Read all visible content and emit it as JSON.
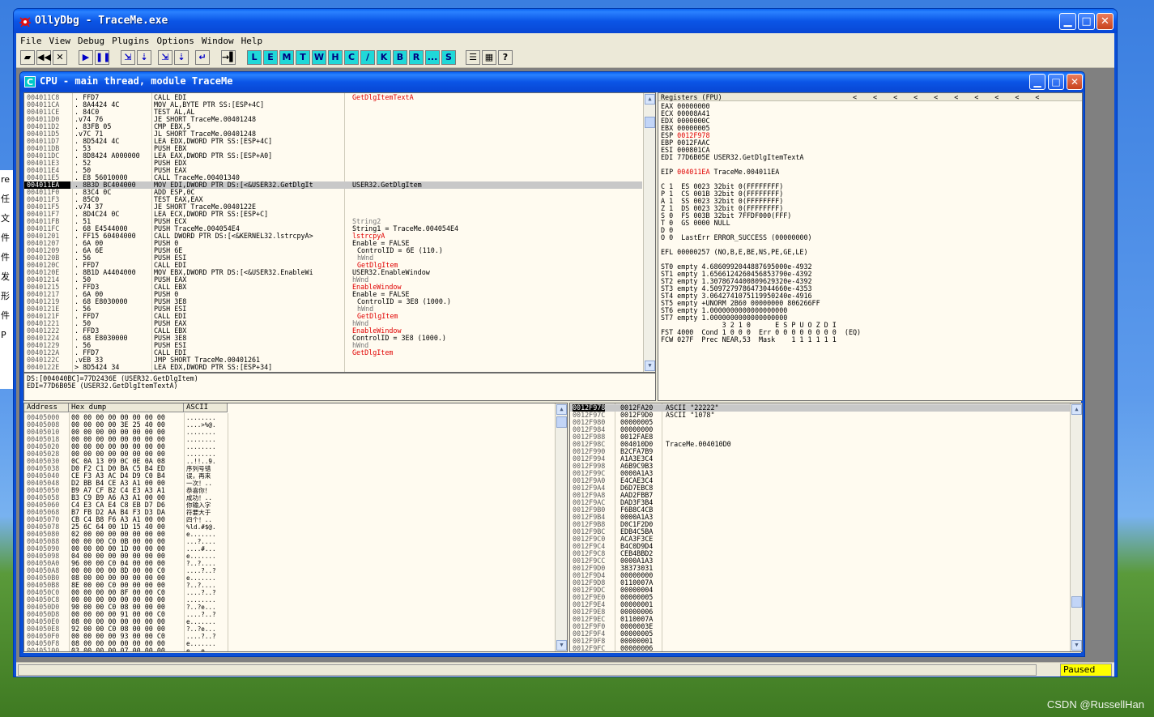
{
  "app": {
    "title": "OllyDbg - TraceMe.exe"
  },
  "menu": [
    "File",
    "View",
    "Debug",
    "Plugins",
    "Options",
    "Window",
    "Help"
  ],
  "toolbar": {
    "letters": [
      "L",
      "E",
      "M",
      "T",
      "W",
      "H",
      "C",
      "/",
      "K",
      "B",
      "R",
      "...",
      "S"
    ]
  },
  "desktop_strip": [
    "re",
    "任",
    "文",
    "件",
    "件",
    "发",
    "形",
    "件",
    "P"
  ],
  "watermark": "CSDN @RussellHan",
  "cpu": {
    "title": "CPU - main thread, module TraceMe",
    "icon_letter": "C",
    "disasm": [
      {
        "addr": "004011C8",
        "hex": ". FFD7",
        "ins": "CALL EDI",
        "com": "GetDlgItemTextA",
        "red": true
      },
      {
        "addr": "004011CA",
        "hex": ". 8A4424 4C",
        "ins": "MOV AL,BYTE PTR SS:[ESP+4C]",
        "com": ""
      },
      {
        "addr": "004011CE",
        "hex": ". 84C0",
        "ins": "TEST AL,AL",
        "com": ""
      },
      {
        "addr": "004011D0",
        "hex": ".v74 76",
        "ins": "JE SHORT TraceMe.00401248",
        "com": ""
      },
      {
        "addr": "004011D2",
        "hex": ". 83FB 05",
        "ins": "CMP EBX,5",
        "com": ""
      },
      {
        "addr": "004011D5",
        "hex": ".v7C 71",
        "ins": "JL SHORT TraceMe.00401248",
        "com": ""
      },
      {
        "addr": "004011D7",
        "hex": ". 8D5424 4C",
        "ins": "LEA EDX,DWORD PTR SS:[ESP+4C]",
        "com": ""
      },
      {
        "addr": "004011DB",
        "hex": ". 53",
        "ins": "PUSH EBX",
        "com": ""
      },
      {
        "addr": "004011DC",
        "hex": ". 8D8424 A000000",
        "ins": "LEA EAX,DWORD PTR SS:[ESP+A0]",
        "com": ""
      },
      {
        "addr": "004011E3",
        "hex": ". 52",
        "ins": "PUSH EDX",
        "com": ""
      },
      {
        "addr": "004011E4",
        "hex": ". 50",
        "ins": "PUSH EAX",
        "com": ""
      },
      {
        "addr": "004011E5",
        "hex": ". E8 56010000",
        "ins": "CALL TraceMe.00401340",
        "com": ""
      },
      {
        "addr": "004011EA",
        "hex": ". 8B3D BC404000",
        "ins": "MOV EDI,DWORD PTR DS:[<&USER32.GetDlgIt",
        "com": "USER32.GetDlgItem",
        "sel": true
      },
      {
        "addr": "004011F0",
        "hex": ". 83C4 0C",
        "ins": "ADD ESP,0C",
        "com": ""
      },
      {
        "addr": "004011F3",
        "hex": ". 85C0",
        "ins": "TEST EAX,EAX",
        "com": ""
      },
      {
        "addr": "004011F5",
        "hex": ".v74 37",
        "ins": "JE SHORT TraceMe.0040122E",
        "com": ""
      },
      {
        "addr": "004011F7",
        "hex": ". 8D4C24 0C",
        "ins": "LEA ECX,DWORD PTR SS:[ESP+C]",
        "com": ""
      },
      {
        "addr": "004011FB",
        "hex": ". 51",
        "ins": "PUSH ECX",
        "com": "String2",
        "gray": true
      },
      {
        "addr": "004011FC",
        "hex": ". 68 E4544000",
        "ins": "PUSH TraceMe.004054E4",
        "com": "String1 = TraceMe.004054E4"
      },
      {
        "addr": "00401201",
        "hex": ". FF15 60404000",
        "ins": "CALL DWORD PTR DS:[<&KERNEL32.lstrcpyA>",
        "com": "lstrcpyA",
        "red": true
      },
      {
        "addr": "00401207",
        "hex": ". 6A 00",
        "ins": "PUSH 0",
        "com": "Enable = FALSE"
      },
      {
        "addr": "00401209",
        "hex": ". 6A 6E",
        "ins": "PUSH 6E",
        "com": "ControlID = 6E (110.)",
        "indent": true
      },
      {
        "addr": "0040120B",
        "hex": ". 56",
        "ins": "PUSH ESI",
        "com": "hWnd",
        "indent": true,
        "gray": true
      },
      {
        "addr": "0040120C",
        "hex": ". FFD7",
        "ins": "CALL EDI",
        "com": "GetDlgItem",
        "indent": true,
        "red": true
      },
      {
        "addr": "0040120E",
        "hex": ". 8B1D A4404000",
        "ins": "MOV EBX,DWORD PTR DS:[<&USER32.EnableWi",
        "com": "USER32.EnableWindow"
      },
      {
        "addr": "00401214",
        "hex": ". 50",
        "ins": "PUSH EAX",
        "com": "hWnd",
        "gray": true
      },
      {
        "addr": "00401215",
        "hex": ". FFD3",
        "ins": "CALL EBX",
        "com": "EnableWindow",
        "red": true
      },
      {
        "addr": "00401217",
        "hex": ". 6A 00",
        "ins": "PUSH 0",
        "com": "Enable = FALSE"
      },
      {
        "addr": "00401219",
        "hex": ". 68 E8030000",
        "ins": "PUSH 3E8",
        "com": "ControlID = 3E8 (1000.)",
        "indent": true
      },
      {
        "addr": "0040121E",
        "hex": ". 56",
        "ins": "PUSH ESI",
        "com": "hWnd",
        "indent": true,
        "gray": true
      },
      {
        "addr": "0040121F",
        "hex": ". FFD7",
        "ins": "CALL EDI",
        "com": "GetDlgItem",
        "indent": true,
        "red": true
      },
      {
        "addr": "00401221",
        "hex": ". 50",
        "ins": "PUSH EAX",
        "com": "hWnd",
        "gray": true
      },
      {
        "addr": "00401222",
        "hex": ". FFD3",
        "ins": "CALL EBX",
        "com": "EnableWindow",
        "red": true
      },
      {
        "addr": "00401224",
        "hex": ". 68 E8030000",
        "ins": "PUSH 3E8",
        "com": "ControlID = 3E8 (1000.)"
      },
      {
        "addr": "00401229",
        "hex": ". 56",
        "ins": "PUSH ESI",
        "com": "hWnd",
        "gray": true
      },
      {
        "addr": "0040122A",
        "hex": ". FFD7",
        "ins": "CALL EDI",
        "com": "GetDlgItem",
        "red": true
      },
      {
        "addr": "0040122C",
        "hex": ".vEB 33",
        "ins": "JMP SHORT TraceMe.00401261",
        "com": ""
      },
      {
        "addr": "0040122E",
        "hex": "> 8D5424 34",
        "ins": "LEA EDX,DWORD PTR SS:[ESP+34]",
        "com": ""
      }
    ],
    "info_lines": [
      "DS:[004040BC]=77D2436E (USER32.GetDlgItem)",
      "EDI=77D6B05E (USER32.GetDlgItemTextA)"
    ],
    "registers": {
      "header": "Registers (FPU)",
      "lines": [
        {
          "t": "EAX 00000000"
        },
        {
          "t": "ECX 00008A41"
        },
        {
          "t": "EDX 0000000C"
        },
        {
          "t": "EBX 00000005"
        },
        {
          "t": "ESP ",
          "v": "0012F978",
          "red": true
        },
        {
          "t": "EBP 0012FAAC"
        },
        {
          "t": "ESI 000801CA"
        },
        {
          "t": "EDI 77D6B05E USER32.GetDlgItemTextA"
        },
        {
          "t": ""
        },
        {
          "t": "EIP ",
          "v": "004011EA",
          "red": true,
          "rest": " TraceMe.004011EA"
        },
        {
          "t": ""
        },
        {
          "t": "C 1  ES 0023 32bit 0(FFFFFFFF)"
        },
        {
          "t": "P 1  CS 001B 32bit 0(FFFFFFFF)"
        },
        {
          "t": "A 1  SS 0023 32bit 0(FFFFFFFF)"
        },
        {
          "t": "Z 1  DS 0023 32bit 0(FFFFFFFF)"
        },
        {
          "t": "S 0  FS 003B 32bit 7FFDF000(FFF)"
        },
        {
          "t": "T 0  GS 0000 NULL"
        },
        {
          "t": "D 0"
        },
        {
          "t": "O 0  LastErr ERROR_SUCCESS (00000000)"
        },
        {
          "t": ""
        },
        {
          "t": "EFL 00000257 (NO,B,E,BE,NS,PE,GE,LE)"
        },
        {
          "t": ""
        },
        {
          "t": "ST0 empty 4.6860992044887695000e-4932"
        },
        {
          "t": "ST1 empty 1.6566124260456853790e-4392"
        },
        {
          "t": "ST2 empty 1.3078674400809629320e-4392"
        },
        {
          "t": "ST3 empty 4.5097279786473044660e-4353"
        },
        {
          "t": "ST4 empty 3.0642741075119950240e-4916"
        },
        {
          "t": "ST5 empty +UNORM 2B60 00000000 806266FF"
        },
        {
          "t": "ST6 empty 1.0000000000000000000"
        },
        {
          "t": "ST7 empty 1.0000000000000000000"
        },
        {
          "t": "               3 2 1 0      E S P U O Z D I"
        },
        {
          "t": "FST 4000  Cond 1 0 0 0  Err 0 0 0 0 0 0 0 0  (EQ)"
        },
        {
          "t": "FCW 027F  Prec NEAR,53  Mask    1 1 1 1 1 1"
        }
      ]
    },
    "dump": {
      "headers": [
        "Address",
        "Hex dump",
        "ASCII"
      ],
      "rows": [
        {
          "a": "00405000",
          "h": "00 00 00 00 00 00 00 00",
          "s": "........"
        },
        {
          "a": "00405008",
          "h": "00 00 00 00 3E 25 40 00",
          "s": "....>%@."
        },
        {
          "a": "00405010",
          "h": "00 00 00 00 00 00 00 00",
          "s": "........"
        },
        {
          "a": "00405018",
          "h": "00 00 00 00 00 00 00 00",
          "s": "........"
        },
        {
          "a": "00405020",
          "h": "00 00 00 00 00 00 00 00",
          "s": "........"
        },
        {
          "a": "00405028",
          "h": "00 00 00 00 00 00 00 00",
          "s": "........"
        },
        {
          "a": "00405030",
          "h": "0C 0A 13 09 0C 0E 0A 08",
          "s": "..!!..9."
        },
        {
          "a": "00405038",
          "h": "D0 F2 C1 D0 BA C5 B4 ED",
          "s": "序列号错"
        },
        {
          "a": "00405040",
          "h": "CE F3 A3 AC D4 D9 C0 B4",
          "s": "误，再来"
        },
        {
          "a": "00405048",
          "h": "D2 BB B4 CE A3 A1 00 00",
          "s": "一次！.."
        },
        {
          "a": "00405050",
          "h": "B9 A7 CF B2 C4 E3 A3 A1",
          "s": "恭喜你！"
        },
        {
          "a": "00405058",
          "h": "B3 C9 B9 A6 A3 A1 00 00",
          "s": "成功！.."
        },
        {
          "a": "00405060",
          "h": "C4 E3 CA E4 C8 EB D7 D6",
          "s": "你输入字"
        },
        {
          "a": "00405068",
          "h": "B7 FB D2 AA B4 F3 D3 DA",
          "s": "符要大于"
        },
        {
          "a": "00405070",
          "h": "CB C4 B8 F6 A3 A1 00 00",
          "s": "四个！.."
        },
        {
          "a": "00405078",
          "h": "25 6C 64 00 1D 15 40 00",
          "s": "%ld.#$@."
        },
        {
          "a": "00405080",
          "h": "02 00 00 00 00 00 00 00",
          "s": "e......."
        },
        {
          "a": "00405088",
          "h": "00 00 00 C0 0B 00 00 00",
          "s": "...?...."
        },
        {
          "a": "00405090",
          "h": "00 00 00 00 1D 00 00 00",
          "s": "....#..."
        },
        {
          "a": "00405098",
          "h": "04 00 00 00 00 00 00 00",
          "s": "e......."
        },
        {
          "a": "004050A0",
          "h": "96 00 00 C0 04 00 00 00",
          "s": "?..?...."
        },
        {
          "a": "004050A8",
          "h": "00 00 00 00 8D 00 00 C0",
          "s": "....?..?"
        },
        {
          "a": "004050B0",
          "h": "08 00 00 00 00 00 00 00",
          "s": "e......."
        },
        {
          "a": "004050B8",
          "h": "8E 00 00 C0 00 00 00 00",
          "s": "?..?...."
        },
        {
          "a": "004050C0",
          "h": "00 00 00 00 8F 00 00 C0",
          "s": "....?..?"
        },
        {
          "a": "004050C8",
          "h": "00 00 00 00 00 00 00 00",
          "s": "........"
        },
        {
          "a": "004050D0",
          "h": "90 00 00 C0 08 00 00 00",
          "s": "?..?e..."
        },
        {
          "a": "004050D8",
          "h": "00 00 00 00 91 00 00 C0",
          "s": "....?..?"
        },
        {
          "a": "004050E0",
          "h": "08 00 00 00 00 00 00 00",
          "s": "e......."
        },
        {
          "a": "004050E8",
          "h": "92 00 00 C0 08 00 00 00",
          "s": "?..?e..."
        },
        {
          "a": "004050F0",
          "h": "00 00 00 00 93 00 00 C0",
          "s": "....?..?"
        },
        {
          "a": "004050F8",
          "h": "08 00 00 00 00 00 00 00",
          "s": "e......."
        },
        {
          "a": "00405100",
          "h": "03 00 00 00 07 00 00 00",
          "s": "e...e..."
        }
      ]
    },
    "stack": [
      {
        "a": "0012F978",
        "v": "0012FA20",
        "c": "ASCII \"22222\"",
        "sel": true
      },
      {
        "a": "0012F97C",
        "v": "0012F9D0",
        "c": "ASCII \"1078\""
      },
      {
        "a": "0012F980",
        "v": "00000005",
        "c": ""
      },
      {
        "a": "0012F984",
        "v": "00000000",
        "c": ""
      },
      {
        "a": "0012F988",
        "v": "0012FAE8",
        "c": ""
      },
      {
        "a": "0012F98C",
        "v": "004010D0",
        "c": "TraceMe.004010D0"
      },
      {
        "a": "0012F990",
        "v": "B2CFA7B9",
        "c": ""
      },
      {
        "a": "0012F994",
        "v": "A1A3E3C4",
        "c": ""
      },
      {
        "a": "0012F998",
        "v": "A6B9C9B3",
        "c": ""
      },
      {
        "a": "0012F99C",
        "v": "0000A1A3",
        "c": ""
      },
      {
        "a": "0012F9A0",
        "v": "E4CAE3C4",
        "c": ""
      },
      {
        "a": "0012F9A4",
        "v": "D6D7EBC8",
        "c": ""
      },
      {
        "a": "0012F9A8",
        "v": "AAD2FBB7",
        "c": ""
      },
      {
        "a": "0012F9AC",
        "v": "DAD3F3B4",
        "c": ""
      },
      {
        "a": "0012F9B0",
        "v": "F6B8C4CB",
        "c": ""
      },
      {
        "a": "0012F9B4",
        "v": "0000A1A3",
        "c": ""
      },
      {
        "a": "0012F9B8",
        "v": "D0C1F2D0",
        "c": ""
      },
      {
        "a": "0012F9BC",
        "v": "EDB4C5BA",
        "c": ""
      },
      {
        "a": "0012F9C0",
        "v": "ACA3F3CE",
        "c": ""
      },
      {
        "a": "0012F9C4",
        "v": "B4C0D9D4",
        "c": ""
      },
      {
        "a": "0012F9C8",
        "v": "CEB4BBD2",
        "c": ""
      },
      {
        "a": "0012F9CC",
        "v": "0000A1A3",
        "c": ""
      },
      {
        "a": "0012F9D0",
        "v": "38373031",
        "c": ""
      },
      {
        "a": "0012F9D4",
        "v": "00000000",
        "c": ""
      },
      {
        "a": "0012F9D8",
        "v": "0110007A",
        "c": ""
      },
      {
        "a": "0012F9DC",
        "v": "00000004",
        "c": ""
      },
      {
        "a": "0012F9E0",
        "v": "00000005",
        "c": ""
      },
      {
        "a": "0012F9E4",
        "v": "00000001",
        "c": ""
      },
      {
        "a": "0012F9E8",
        "v": "00000006",
        "c": ""
      },
      {
        "a": "0012F9EC",
        "v": "0110007A",
        "c": ""
      },
      {
        "a": "0012F9F0",
        "v": "0000003E",
        "c": ""
      },
      {
        "a": "0012F9F4",
        "v": "00000005",
        "c": ""
      },
      {
        "a": "0012F9F8",
        "v": "00000001",
        "c": ""
      },
      {
        "a": "0012F9FC",
        "v": "00000006",
        "c": ""
      }
    ]
  },
  "status": {
    "message": "",
    "state": "Paused"
  }
}
